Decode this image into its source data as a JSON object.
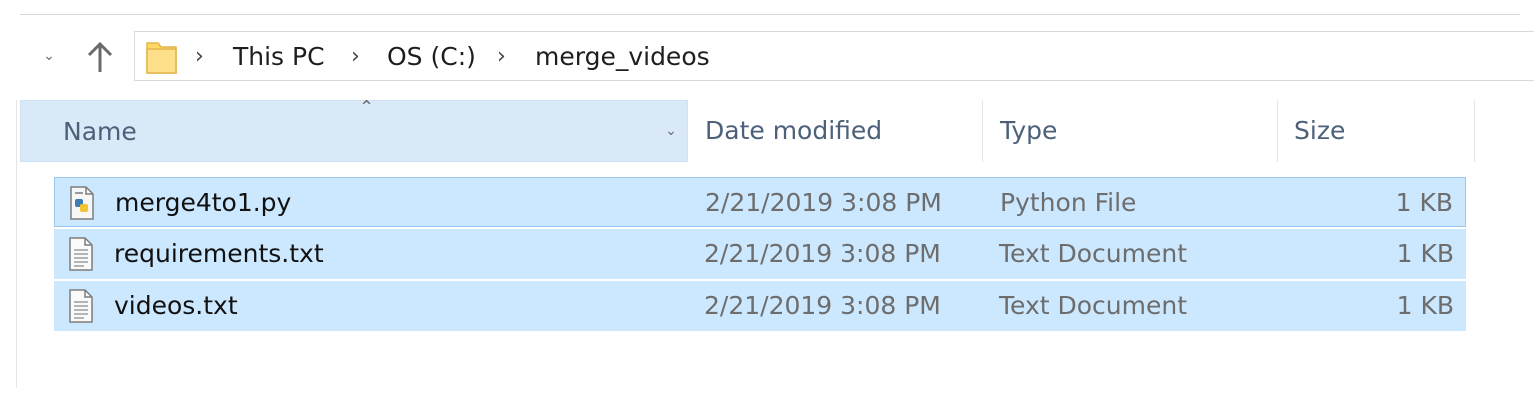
{
  "breadcrumb": [
    "This PC",
    "OS (C:)",
    "merge_videos"
  ],
  "columns": {
    "name": "Name",
    "date": "Date modified",
    "type": "Type",
    "size": "Size"
  },
  "files": [
    {
      "name": "merge4to1.py",
      "date": "2/21/2019 3:08 PM",
      "type": "Python File",
      "size": "1 KB",
      "icon": "python-file-icon"
    },
    {
      "name": "requirements.txt",
      "date": "2/21/2019 3:08 PM",
      "type": "Text Document",
      "size": "1 KB",
      "icon": "text-file-icon"
    },
    {
      "name": "videos.txt",
      "date": "2/21/2019 3:08 PM",
      "type": "Text Document",
      "size": "1 KB",
      "icon": "text-file-icon"
    }
  ],
  "colors": {
    "selection": "#cce8ff",
    "header_highlight": "#d9e9f8",
    "folder": "#ffd866"
  }
}
